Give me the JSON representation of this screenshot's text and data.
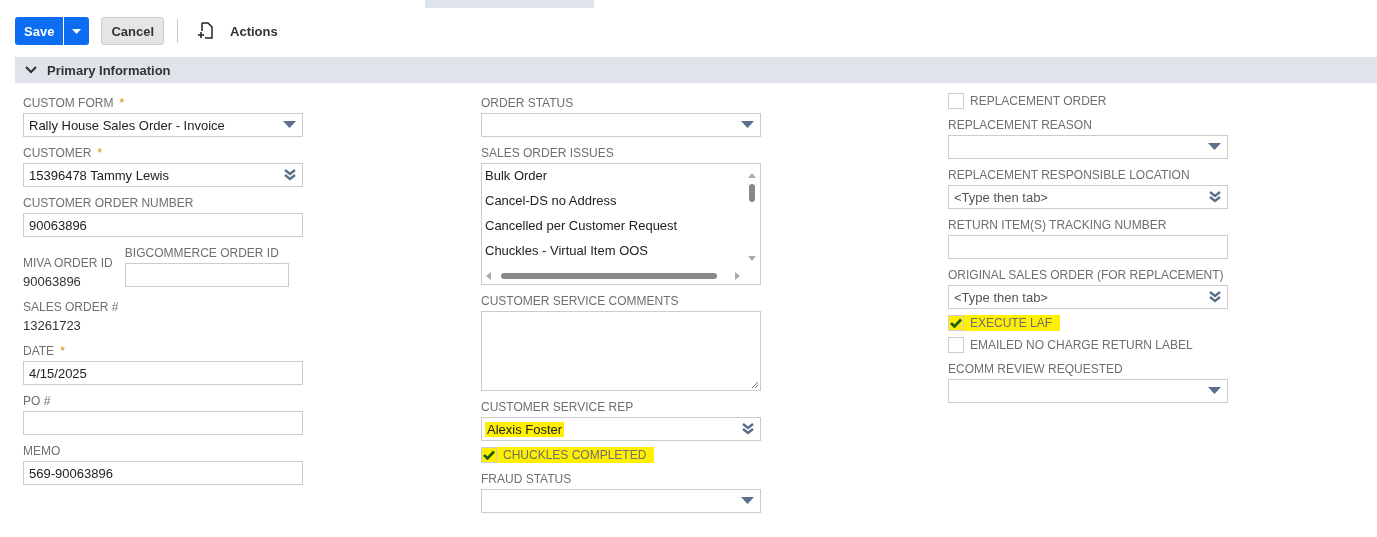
{
  "toolbar": {
    "save": "Save",
    "cancel": "Cancel",
    "actions": "Actions"
  },
  "section": {
    "title": "Primary Information",
    "expanded": true
  },
  "columns": [
    [
      {
        "kind": "select",
        "label": "CUSTOM FORM",
        "required_mark": "*",
        "value": "Rally House Sales Order - Invoice"
      },
      {
        "kind": "lookup",
        "label": "CUSTOMER",
        "required_mark": "*",
        "value": "15396478 Tammy Lewis"
      },
      {
        "kind": "text",
        "label": "CUSTOMER ORDER NUMBER",
        "value": "90063896"
      },
      {
        "kind": "pair",
        "left": {
          "label": "MIVA ORDER ID",
          "value": "90063896"
        },
        "right": {
          "label": "BIGCOMMERCE ORDER ID"
        }
      },
      {
        "kind": "readonly",
        "label": "SALES ORDER #",
        "value": "13261723"
      },
      {
        "kind": "text",
        "label": "DATE",
        "required_mark": "*",
        "value": "4/15/2025"
      },
      {
        "kind": "text",
        "label": "PO #"
      },
      {
        "kind": "text",
        "label": "MEMO",
        "value": "569-90063896"
      }
    ],
    [
      {
        "kind": "select",
        "label": "ORDER STATUS"
      },
      {
        "kind": "listbox",
        "label": "SALES ORDER ISSUES",
        "options": [
          "Bulk Order",
          "Cancel-DS no Address",
          "Cancelled per Customer Request",
          "Chuckles - Virtual Item OOS"
        ]
      },
      {
        "kind": "textarea",
        "label": "CUSTOMER SERVICE COMMENTS"
      },
      {
        "kind": "lookup",
        "label": "CUSTOMER SERVICE REP",
        "value": "Alexis Foster",
        "highlighted": true
      },
      {
        "kind": "checkbox",
        "label": "CHUCKLES COMPLETED",
        "checked": true,
        "highlighted": true
      },
      {
        "kind": "select",
        "label": "FRAUD STATUS"
      }
    ],
    [
      {
        "kind": "checkbox",
        "label": "REPLACEMENT ORDER",
        "checked": false,
        "highlighted": false
      },
      {
        "kind": "select",
        "label": "REPLACEMENT REASON"
      },
      {
        "kind": "lookup",
        "label": "REPLACEMENT RESPONSIBLE LOCATION",
        "placeholder": "<Type then tab>"
      },
      {
        "kind": "text",
        "label": "RETURN ITEM(S) TRACKING NUMBER"
      },
      {
        "kind": "lookup",
        "label": "ORIGINAL SALES ORDER (FOR REPLACEMENT)",
        "placeholder": "<Type then tab>"
      },
      {
        "kind": "checkbox",
        "label": "EXECUTE LAF",
        "checked": true,
        "highlighted": true
      },
      {
        "kind": "checkbox",
        "label": "EMAILED NO CHARGE RETURN LABEL",
        "checked": false,
        "highlighted": false
      },
      {
        "kind": "select",
        "label": "ECOMM REVIEW REQUESTED"
      }
    ]
  ]
}
